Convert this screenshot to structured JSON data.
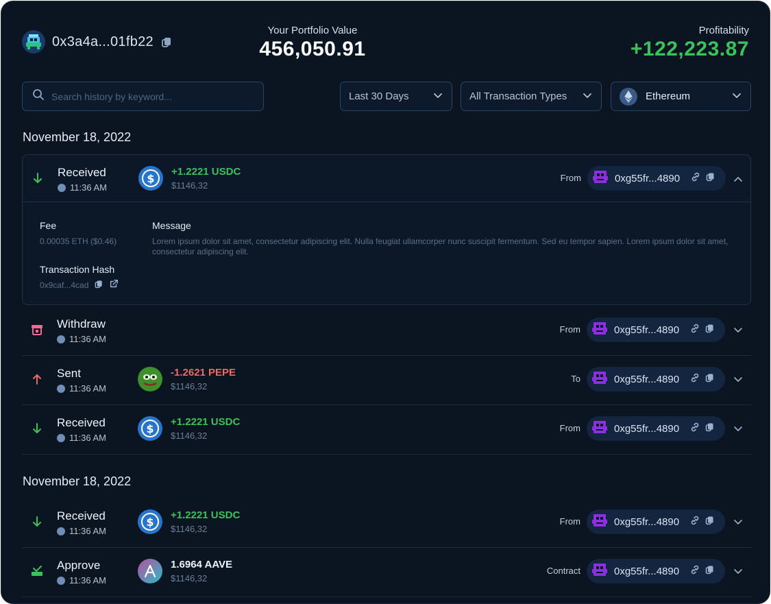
{
  "header": {
    "wallet_address": "0x3a4a...01fb22",
    "portfolio_label": "Your Portfolio Value",
    "portfolio_value": "456,050.91",
    "profit_label": "Profitability",
    "profit_value": "+122,223.87"
  },
  "filters": {
    "search_placeholder": "Search history by keyword...",
    "date_range": "Last 30 Days",
    "tx_type": "All Transaction Types",
    "network": "Ethereum"
  },
  "groups": [
    {
      "date": "November 18, 2022"
    },
    {
      "date": "November 18, 2022"
    }
  ],
  "transactions": [
    {
      "type": "Received",
      "time": "11:36 AM",
      "amount": "+1.2221 USDC",
      "usd": "$1146,32",
      "dir_label": "From",
      "address": "0xg55fr...4890",
      "expanded": true,
      "token": "usdc"
    },
    {
      "type": "Withdraw",
      "time": "11:36 AM",
      "amount": "",
      "usd": "",
      "dir_label": "From",
      "address": "0xg55fr...4890",
      "token": "none"
    },
    {
      "type": "Sent",
      "time": "11:36 AM",
      "amount": "-1.2621 PEPE",
      "usd": "$1146,32",
      "dir_label": "To",
      "address": "0xg55fr...4890",
      "token": "pepe"
    },
    {
      "type": "Received",
      "time": "11:36 AM",
      "amount": "+1.2221 USDC",
      "usd": "$1146,32",
      "dir_label": "From",
      "address": "0xg55fr...4890",
      "token": "usdc"
    },
    {
      "type": "Received",
      "time": "11:36 AM",
      "amount": "+1.2221 USDC",
      "usd": "$1146,32",
      "dir_label": "From",
      "address": "0xg55fr...4890",
      "token": "usdc"
    },
    {
      "type": "Approve",
      "time": "11:36 AM",
      "amount": "1.6964 AAVE",
      "usd": "$1146,32",
      "dir_label": "Contract",
      "address": "0xg55fr...4890",
      "token": "aave"
    }
  ],
  "details": {
    "fee_label": "Fee",
    "fee_value": "0.00035 ETH ($0.46)",
    "message_label": "Message",
    "message_value": "Lorem ipsum dolor sit amet, consectetur adipiscing elit. Nulla feugiat ullamcorper nunc suscipit fermentum. Sed eu tempor sapien. Lorem ipsum dolor sit amet, consectetur adipiscing elit.",
    "hash_label": "Transaction Hash",
    "hash_value": "0x9caf...4cad"
  },
  "colors": {
    "background": "#0b1522",
    "positive": "#3bc25b",
    "negative": "#ec6a67",
    "pill": "#142540",
    "avatar_purple": "#8b2fe0"
  }
}
